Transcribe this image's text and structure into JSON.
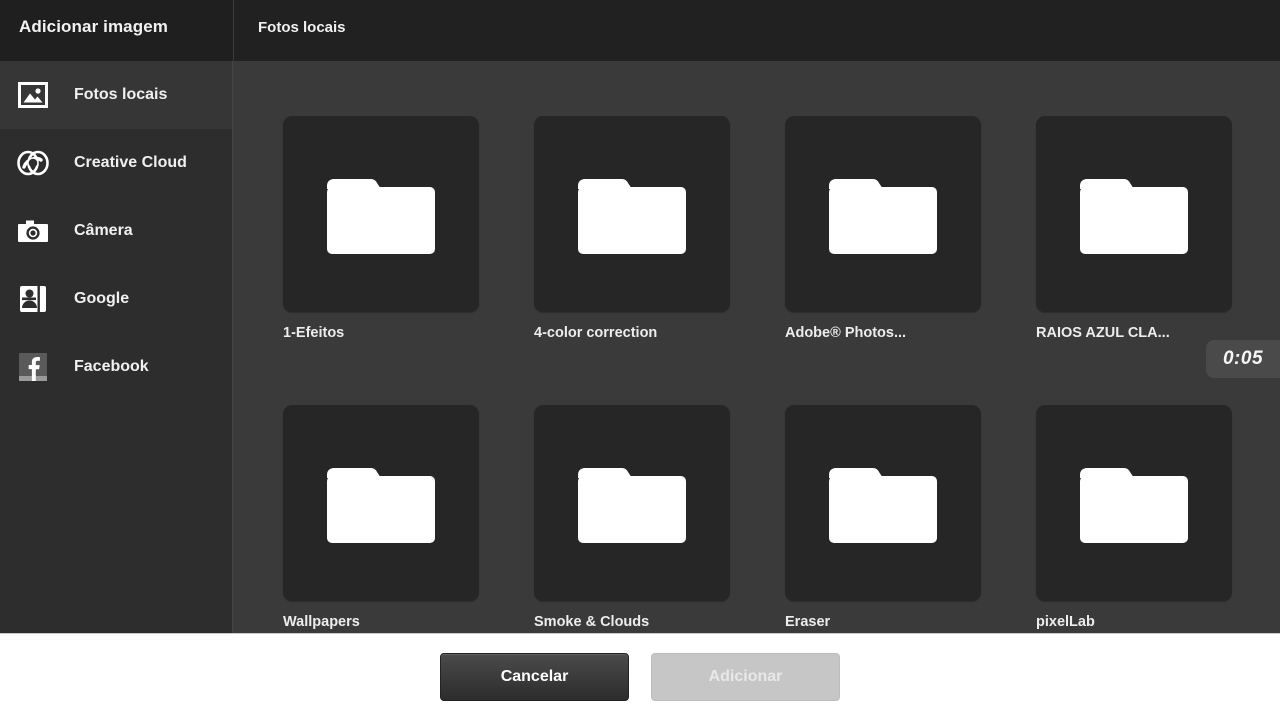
{
  "dialog": {
    "sidebar_title": "Adicionar imagem",
    "content_title": "Fotos locais"
  },
  "sidebar": {
    "items": [
      {
        "label": "Fotos locais",
        "icon": "image-icon",
        "selected": true
      },
      {
        "label": "Creative Cloud",
        "icon": "creative-cloud-icon",
        "selected": false
      },
      {
        "label": "Câmera",
        "icon": "camera-icon",
        "selected": false
      },
      {
        "label": "Google",
        "icon": "google-photos-icon",
        "selected": false
      },
      {
        "label": "Facebook",
        "icon": "facebook-icon",
        "selected": false
      }
    ]
  },
  "grid": {
    "folders": [
      {
        "name": "1-Efeitos",
        "icon": "folder-icon"
      },
      {
        "name": "4-color correction",
        "icon": "folder-icon"
      },
      {
        "name": "Adobe® Photos...",
        "icon": "folder-icon"
      },
      {
        "name": "RAIOS AZUL CLA...",
        "icon": "folder-icon"
      },
      {
        "name": "Wallpapers",
        "icon": "folder-icon"
      },
      {
        "name": "Smoke & Clouds",
        "icon": "folder-icon"
      },
      {
        "name": "Eraser",
        "icon": "folder-icon"
      },
      {
        "name": "pixelLab",
        "icon": "folder-icon"
      }
    ]
  },
  "overlay": {
    "timer": "0:05"
  },
  "footer": {
    "cancel_label": "Cancelar",
    "add_label": "Adicionar"
  },
  "colors": {
    "titlebar": "#1f1f1f",
    "sidebar": "#2d2d2d",
    "content": "#3a3a3a",
    "thumb": "#262626",
    "footer": "#ffffff",
    "text": "#f0f0f0",
    "timer_bg": "#4a4a4a"
  }
}
